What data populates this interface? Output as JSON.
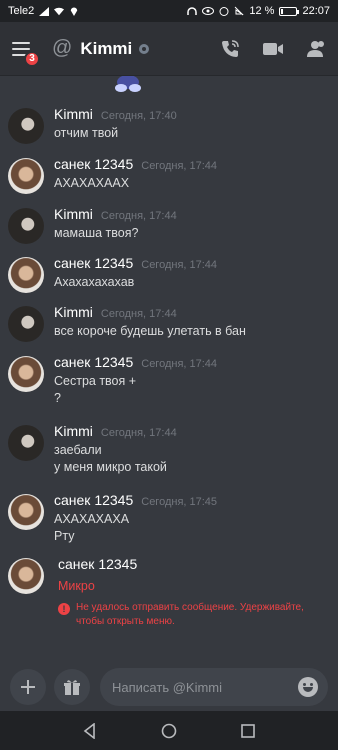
{
  "status_bar": {
    "carrier": "Tele2",
    "battery": "12 %",
    "time": "22:07"
  },
  "header": {
    "badge_count": "3",
    "at_symbol": "@",
    "channel_name": "Kimmi",
    "icons": [
      "menu-icon",
      "at-icon",
      "status-offline-icon",
      "call-icon",
      "video-icon",
      "member-list-icon"
    ]
  },
  "messages": [
    {
      "author": "Kimmi",
      "time": "Сегодня, 17:40",
      "lines": [
        "отчим твой"
      ],
      "avatar": "kimmi"
    },
    {
      "author": "санек 12345",
      "time": "Сегодня, 17:44",
      "lines": [
        "АХАХАХААХ"
      ],
      "avatar": "sanek"
    },
    {
      "author": "Kimmi",
      "time": "Сегодня, 17:44",
      "lines": [
        "мамаша твоя?"
      ],
      "avatar": "kimmi"
    },
    {
      "author": "санек 12345",
      "time": "Сегодня, 17:44",
      "lines": [
        "Ахахахахахав"
      ],
      "avatar": "sanek"
    },
    {
      "author": "Kimmi",
      "time": "Сегодня, 17:44",
      "lines": [
        "все короче будешь улетать в бан"
      ],
      "avatar": "kimmi"
    },
    {
      "author": "санек 12345",
      "time": "Сегодня, 17:44",
      "lines": [
        "Сестра твоя +",
        "?"
      ],
      "avatar": "sanek"
    },
    {
      "author": "Kimmi",
      "time": "Сегодня, 17:44",
      "lines": [
        "заебали",
        "у меня микро такой"
      ],
      "avatar": "kimmi"
    },
    {
      "author": "санек 12345",
      "time": "Сегодня, 17:45",
      "lines": [
        "АХАХАХАХА",
        "Рту"
      ],
      "avatar": "sanek"
    }
  ],
  "failed_message": {
    "author": "санек 12345",
    "text": "Микро",
    "error": "Не удалось отправить сообщение. Удерживайте, чтобы открыть меню."
  },
  "composer": {
    "placeholder": "Написать @Kimmi"
  },
  "colors": {
    "background": "#36393f",
    "header": "#2f3136",
    "error": "#ed4245",
    "badge": "#ed4245"
  }
}
